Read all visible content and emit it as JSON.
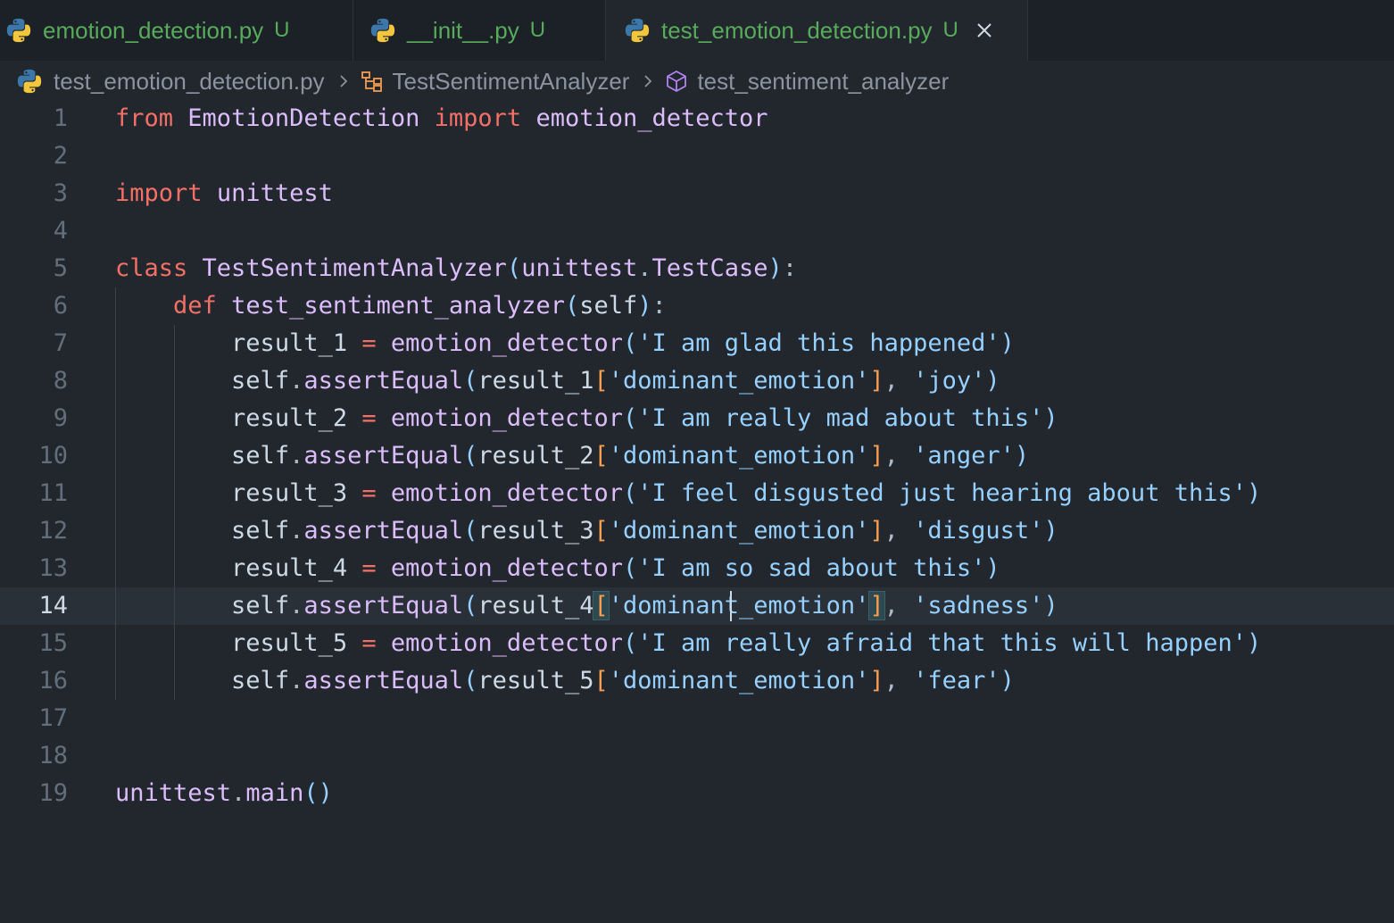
{
  "tabs": [
    {
      "label": "emotion_detection.py",
      "status": "U",
      "active": false
    },
    {
      "label": "__init__.py",
      "status": "U",
      "active": false
    },
    {
      "label": "test_emotion_detection.py",
      "status": "U",
      "active": true
    }
  ],
  "breadcrumb": {
    "file": "test_emotion_detection.py",
    "class": "TestSentimentAnalyzer",
    "method": "test_sentiment_analyzer"
  },
  "editor": {
    "current_line": 14,
    "line_numbers": [
      "1",
      "2",
      "3",
      "4",
      "5",
      "6",
      "7",
      "8",
      "9",
      "10",
      "11",
      "12",
      "13",
      "14",
      "15",
      "16",
      "17",
      "18",
      "19"
    ],
    "lines": [
      [
        [
          "kw",
          "from"
        ],
        [
          "pun",
          " "
        ],
        [
          "mod",
          "EmotionDetection"
        ],
        [
          "pun",
          " "
        ],
        [
          "kw",
          "import"
        ],
        [
          "pun",
          " "
        ],
        [
          "mod",
          "emotion_detector"
        ]
      ],
      [],
      [
        [
          "kw",
          "import"
        ],
        [
          "pun",
          " "
        ],
        [
          "mod",
          "unittest"
        ]
      ],
      [],
      [
        [
          "kw",
          "class"
        ],
        [
          "pun",
          " "
        ],
        [
          "cls",
          "TestSentimentAnalyzer"
        ],
        [
          "par",
          "("
        ],
        [
          "mod",
          "unittest"
        ],
        [
          "pun",
          "."
        ],
        [
          "cls",
          "TestCase"
        ],
        [
          "par",
          ")"
        ],
        [
          "pun",
          ":"
        ]
      ],
      [
        [
          "pun",
          "    "
        ],
        [
          "kw",
          "def"
        ],
        [
          "pun",
          " "
        ],
        [
          "fn",
          "test_sentiment_analyzer"
        ],
        [
          "par",
          "("
        ],
        [
          "var",
          "self"
        ],
        [
          "par",
          ")"
        ],
        [
          "pun",
          ":"
        ]
      ],
      [
        [
          "pun",
          "        "
        ],
        [
          "var",
          "result_1"
        ],
        [
          "pun",
          " "
        ],
        [
          "op",
          "="
        ],
        [
          "pun",
          " "
        ],
        [
          "fn",
          "emotion_detector"
        ],
        [
          "par",
          "("
        ],
        [
          "str",
          "'I am glad this happened'"
        ],
        [
          "par",
          ")"
        ]
      ],
      [
        [
          "pun",
          "        "
        ],
        [
          "var",
          "self"
        ],
        [
          "pun",
          "."
        ],
        [
          "fn",
          "assertEqual"
        ],
        [
          "par",
          "("
        ],
        [
          "var",
          "result_1"
        ],
        [
          "brk",
          "["
        ],
        [
          "str",
          "'dominant_emotion'"
        ],
        [
          "brk",
          "]"
        ],
        [
          "pun",
          ", "
        ],
        [
          "str",
          "'joy'"
        ],
        [
          "par",
          ")"
        ]
      ],
      [
        [
          "pun",
          "        "
        ],
        [
          "var",
          "result_2"
        ],
        [
          "pun",
          " "
        ],
        [
          "op",
          "="
        ],
        [
          "pun",
          " "
        ],
        [
          "fn",
          "emotion_detector"
        ],
        [
          "par",
          "("
        ],
        [
          "str",
          "'I am really mad about this'"
        ],
        [
          "par",
          ")"
        ]
      ],
      [
        [
          "pun",
          "        "
        ],
        [
          "var",
          "self"
        ],
        [
          "pun",
          "."
        ],
        [
          "fn",
          "assertEqual"
        ],
        [
          "par",
          "("
        ],
        [
          "var",
          "result_2"
        ],
        [
          "brk",
          "["
        ],
        [
          "str",
          "'dominant_emotion'"
        ],
        [
          "brk",
          "]"
        ],
        [
          "pun",
          ", "
        ],
        [
          "str",
          "'anger'"
        ],
        [
          "par",
          ")"
        ]
      ],
      [
        [
          "pun",
          "        "
        ],
        [
          "var",
          "result_3"
        ],
        [
          "pun",
          " "
        ],
        [
          "op",
          "="
        ],
        [
          "pun",
          " "
        ],
        [
          "fn",
          "emotion_detector"
        ],
        [
          "par",
          "("
        ],
        [
          "str",
          "'I feel disgusted just hearing about this'"
        ],
        [
          "par",
          ")"
        ]
      ],
      [
        [
          "pun",
          "        "
        ],
        [
          "var",
          "self"
        ],
        [
          "pun",
          "."
        ],
        [
          "fn",
          "assertEqual"
        ],
        [
          "par",
          "("
        ],
        [
          "var",
          "result_3"
        ],
        [
          "brk",
          "["
        ],
        [
          "str",
          "'dominant_emotion'"
        ],
        [
          "brk",
          "]"
        ],
        [
          "pun",
          ", "
        ],
        [
          "str",
          "'disgust'"
        ],
        [
          "par",
          ")"
        ]
      ],
      [
        [
          "pun",
          "        "
        ],
        [
          "var",
          "result_4"
        ],
        [
          "pun",
          " "
        ],
        [
          "op",
          "="
        ],
        [
          "pun",
          " "
        ],
        [
          "fn",
          "emotion_detector"
        ],
        [
          "par",
          "("
        ],
        [
          "str",
          "'I am so sad about this'"
        ],
        [
          "par",
          ")"
        ]
      ],
      [
        [
          "pun",
          "        "
        ],
        [
          "var",
          "self"
        ],
        [
          "pun",
          "."
        ],
        [
          "fn",
          "assertEqual"
        ],
        [
          "par",
          "("
        ],
        [
          "var",
          "result_4"
        ],
        [
          "brk match",
          "["
        ],
        [
          "str",
          "'dominant_emotion'"
        ],
        [
          "brk match",
          "]"
        ],
        [
          "pun",
          ", "
        ],
        [
          "str",
          "'sadness'"
        ],
        [
          "par",
          ")"
        ]
      ],
      [
        [
          "pun",
          "        "
        ],
        [
          "var",
          "result_5"
        ],
        [
          "pun",
          " "
        ],
        [
          "op",
          "="
        ],
        [
          "pun",
          " "
        ],
        [
          "fn",
          "emotion_detector"
        ],
        [
          "par",
          "("
        ],
        [
          "str",
          "'I am really afraid that this will happen'"
        ],
        [
          "par",
          ")"
        ]
      ],
      [
        [
          "pun",
          "        "
        ],
        [
          "var",
          "self"
        ],
        [
          "pun",
          "."
        ],
        [
          "fn",
          "assertEqual"
        ],
        [
          "par",
          "("
        ],
        [
          "var",
          "result_5"
        ],
        [
          "brk",
          "["
        ],
        [
          "str",
          "'dominant_emotion'"
        ],
        [
          "brk",
          "]"
        ],
        [
          "pun",
          ", "
        ],
        [
          "str",
          "'fear'"
        ],
        [
          "par",
          ")"
        ]
      ],
      [],
      [],
      [
        [
          "mod",
          "unittest"
        ],
        [
          "pun",
          "."
        ],
        [
          "fn",
          "main"
        ],
        [
          "par",
          "()"
        ]
      ]
    ]
  },
  "colors": {
    "background": "#22272e",
    "tabbar": "#1c2128",
    "untracked_green": "#57ab5a",
    "keyword": "#f47067",
    "identifier": "#dcbdfb",
    "string": "#96d0ff",
    "bracket": "#f69d50"
  },
  "icons": {
    "tab_file": "python-icon",
    "tab_close": "close-icon",
    "breadcrumb_separator": "chevron-right-icon",
    "class_symbol": "class-symbol-icon",
    "method_symbol": "method-cube-icon"
  }
}
